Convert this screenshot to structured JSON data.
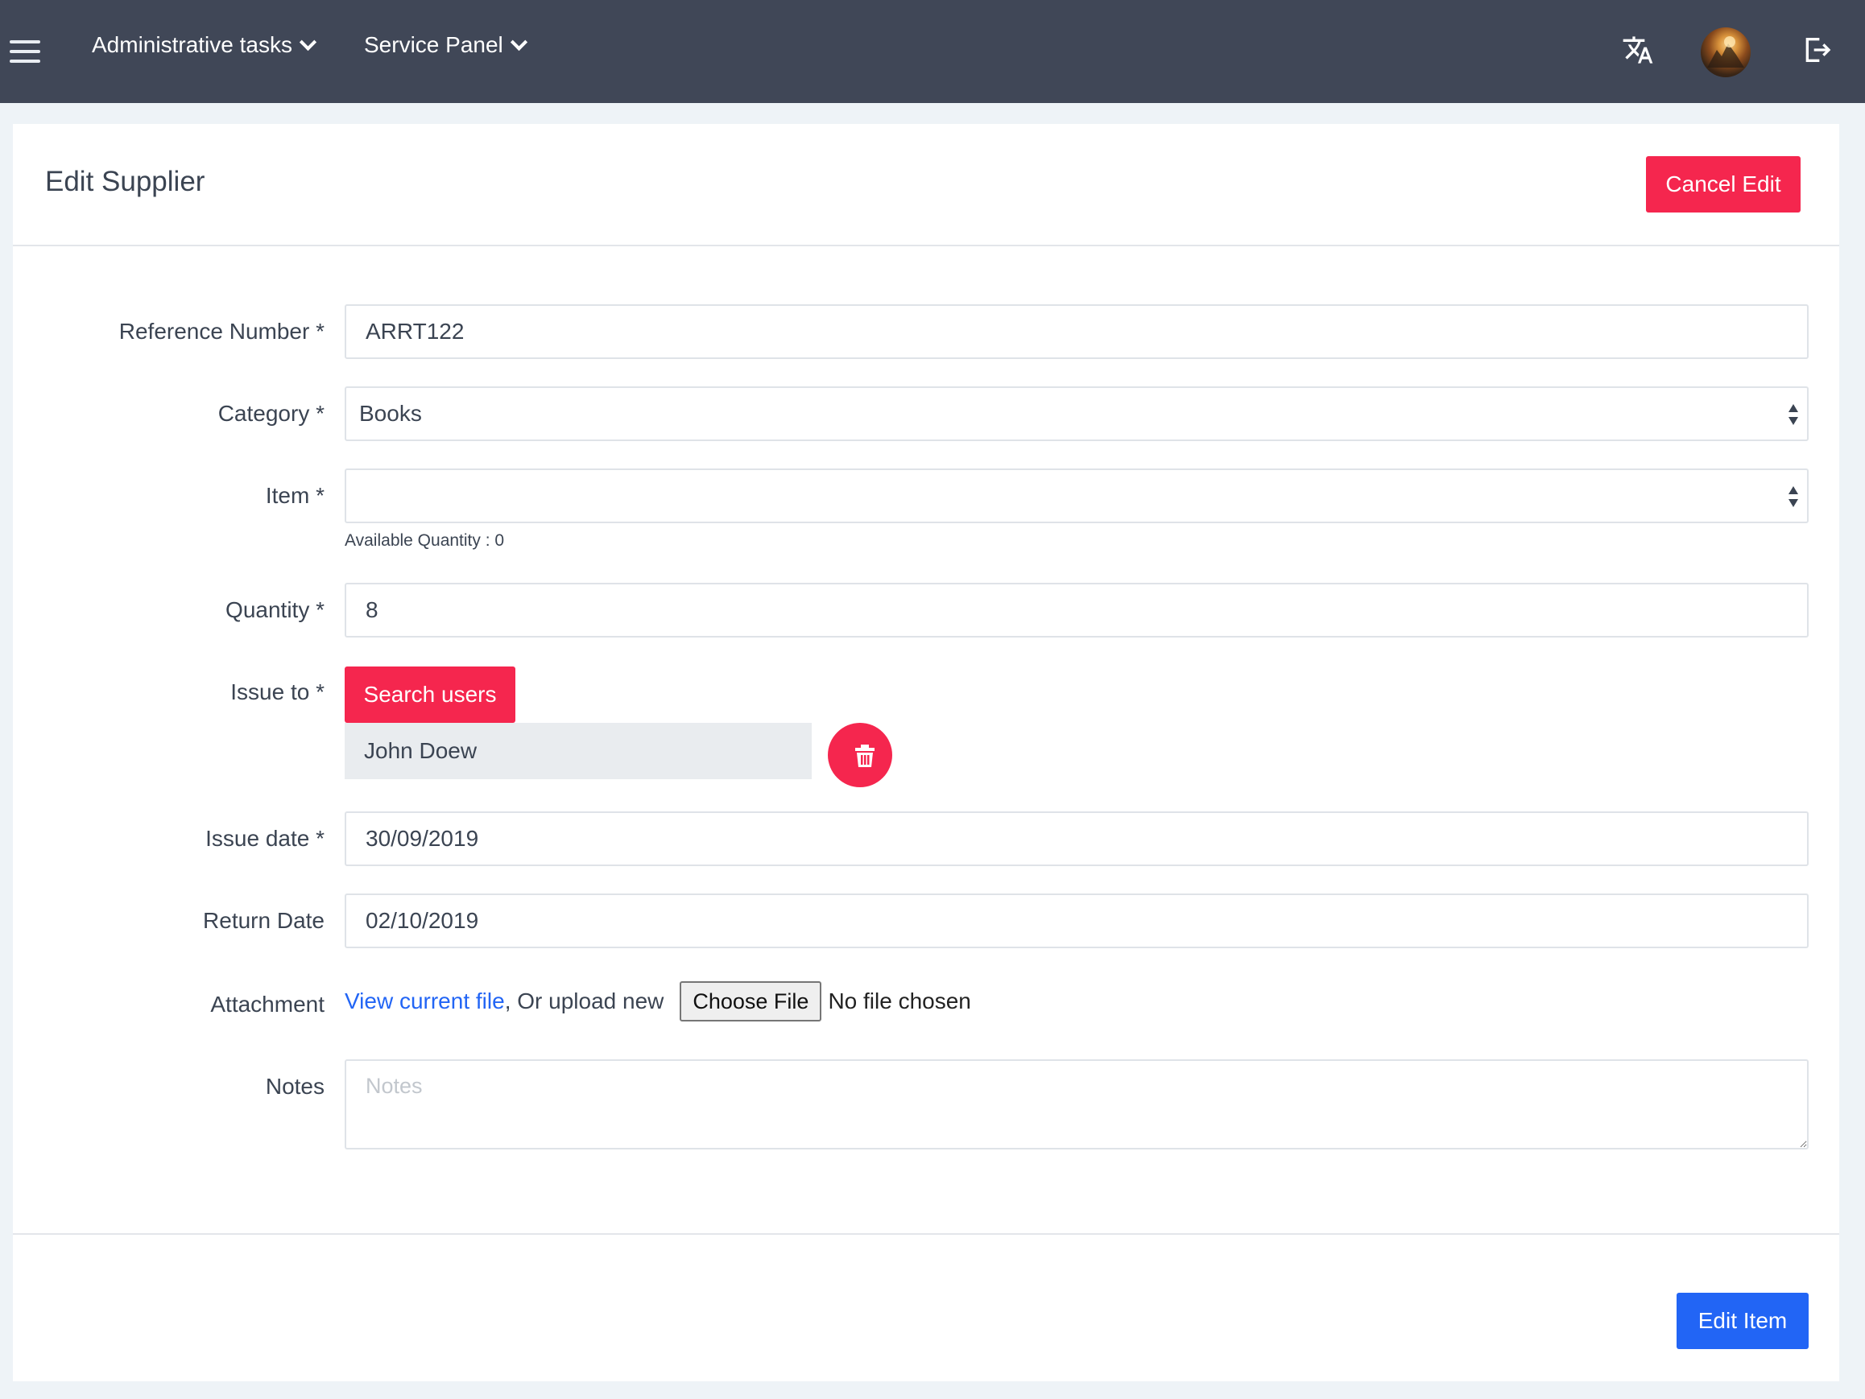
{
  "nav": {
    "menus": [
      {
        "label": "Administrative tasks"
      },
      {
        "label": "Service Panel"
      }
    ]
  },
  "page": {
    "title": "Edit Supplier",
    "cancel_label": "Cancel Edit"
  },
  "form": {
    "reference": {
      "label": "Reference Number *",
      "value": "ARRT122"
    },
    "category": {
      "label": "Category *",
      "value": "Books"
    },
    "item": {
      "label": "Item *",
      "value": "",
      "help": "Available Quantity : 0"
    },
    "quantity": {
      "label": "Quantity *",
      "value": "8"
    },
    "issue_to": {
      "label": "Issue to *",
      "search_label": "Search users",
      "selected_user": "John Doew"
    },
    "issue_date": {
      "label": "Issue date *",
      "value": "30/09/2019"
    },
    "return_date": {
      "label": "Return Date",
      "value": "02/10/2019"
    },
    "attachment": {
      "label": "Attachment",
      "link_text": "View current file",
      "middle_text": ", Or upload new",
      "choose_label": "Choose File",
      "no_file_text": "No file chosen"
    },
    "notes": {
      "label": "Notes",
      "placeholder": "Notes",
      "value": ""
    },
    "submit_label": "Edit Item"
  },
  "colors": {
    "topbar": "#404757",
    "danger": "#f5264e",
    "primary": "#2265f5"
  }
}
